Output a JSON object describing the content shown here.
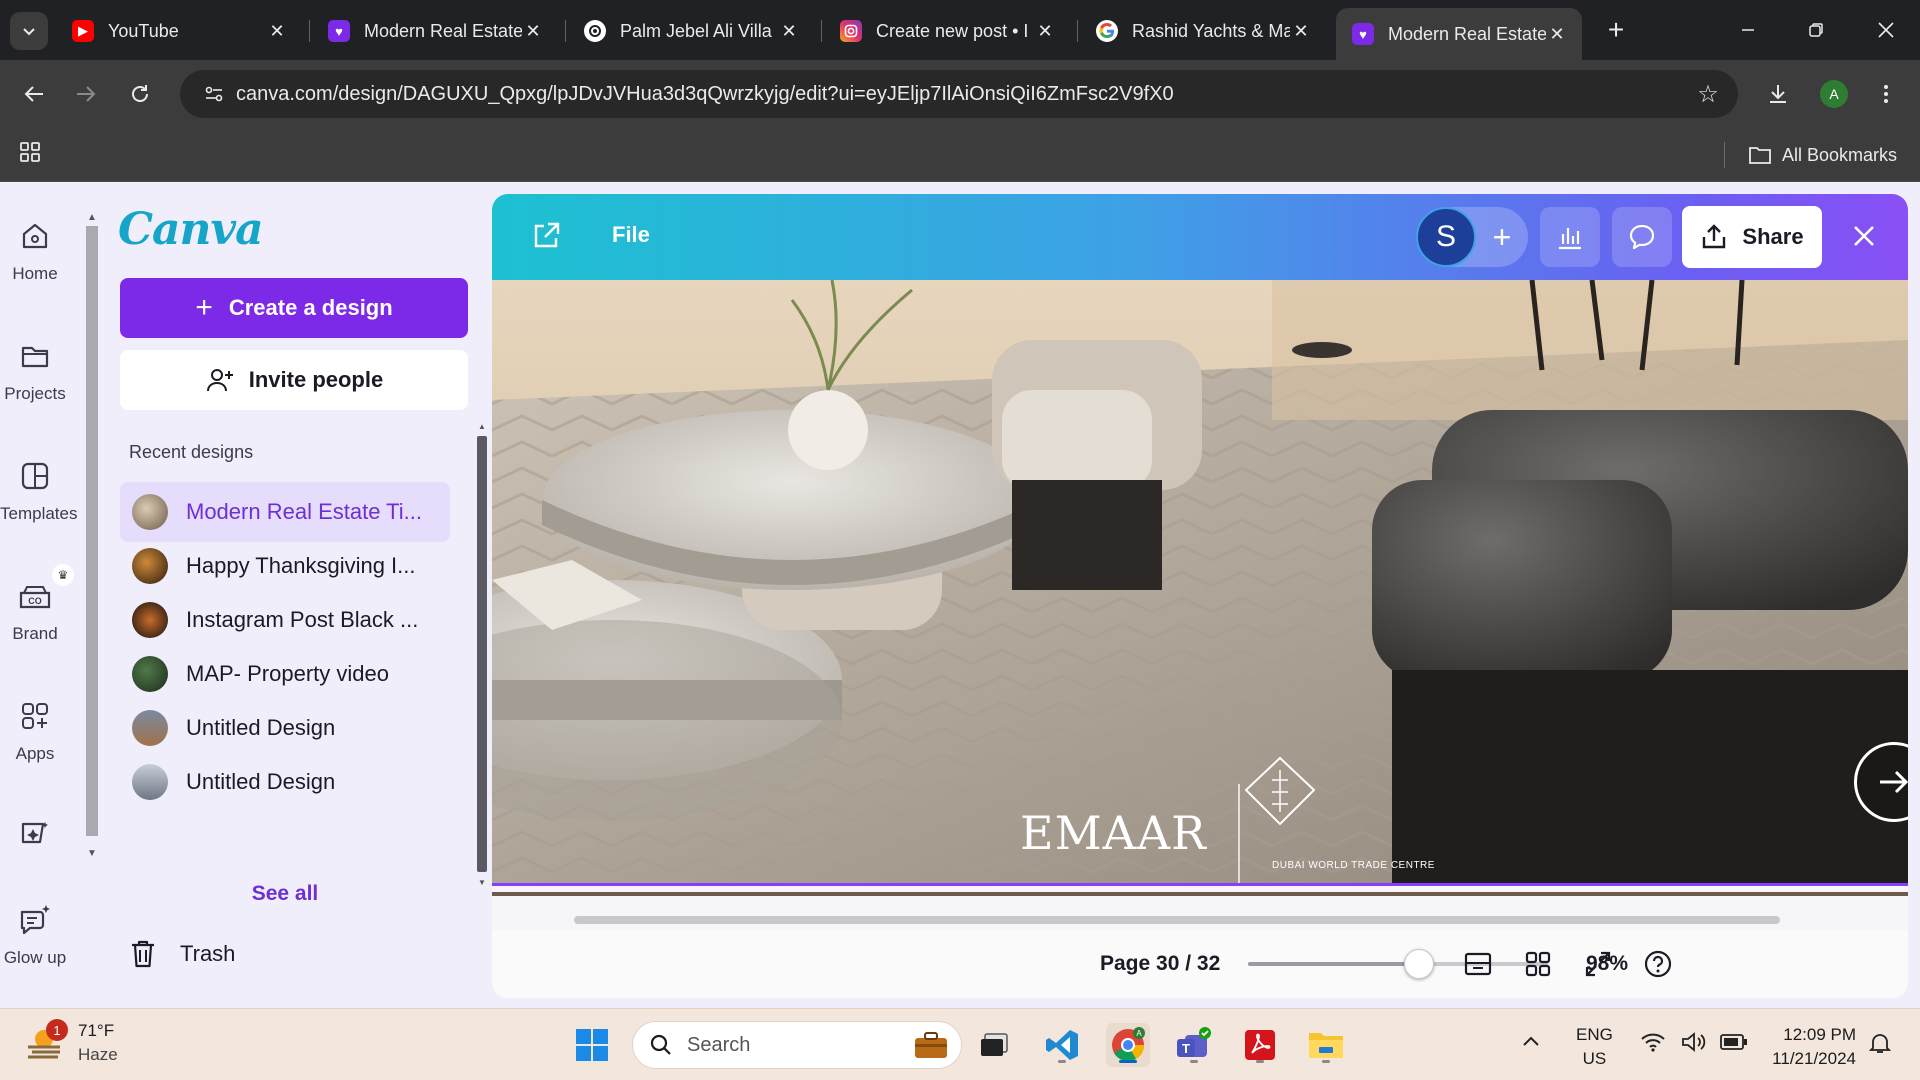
{
  "browser": {
    "tabs": [
      {
        "title": "YouTube",
        "favicon": "youtube-icon",
        "color": "#ff0000"
      },
      {
        "title": "Modern Real Estate",
        "favicon": "canva-heart-icon",
        "color": "#7d2ae8"
      },
      {
        "title": "Palm Jebel Ali Villa",
        "favicon": "chatgpt-icon",
        "color": "#ffffff"
      },
      {
        "title": "Create new post • I",
        "favicon": "instagram-icon",
        "color": "#e1306c"
      },
      {
        "title": "Rashid Yachts & Mar",
        "favicon": "google-icon",
        "color": "#ffffff"
      },
      {
        "title": "Modern Real Estate",
        "favicon": "canva-heart-icon",
        "color": "#7d2ae8",
        "active": true
      }
    ],
    "url": "canva.com/design/DAGUXU_Qpxg/lpJDvJVHua3d3qQwrzkyjg/edit?ui=eyJEljp7IlAiOnsiQiI6ZmFsc2V9fX0",
    "profile_initial": "A",
    "bookmarks_label": "All Bookmarks"
  },
  "canva": {
    "logo": "Canva",
    "rail": [
      {
        "label": "Home",
        "icon": "home-icon"
      },
      {
        "label": "Projects",
        "icon": "folder-icon"
      },
      {
        "label": "Templates",
        "icon": "templates-icon"
      },
      {
        "label": "Brand",
        "icon": "brand-icon"
      },
      {
        "label": "Apps",
        "icon": "apps-icon"
      },
      {
        "label": "",
        "icon": "dream-lab-icon"
      },
      {
        "label": "Glow up",
        "icon": "glow-up-icon"
      }
    ],
    "create_label": "Create a design",
    "invite_label": "Invite people",
    "recent_heading": "Recent designs",
    "recent": [
      {
        "label": "Modern Real Estate Ti...",
        "selected": true
      },
      {
        "label": "Happy Thanksgiving I..."
      },
      {
        "label": "Instagram Post Black ..."
      },
      {
        "label": "MAP- Property video"
      },
      {
        "label": "Untitled Design"
      },
      {
        "label": "Untitled Design"
      }
    ],
    "see_all": "See all",
    "trash": "Trash",
    "viewer": {
      "file_label": "File",
      "collaborator_initial": "S",
      "share_label": "Share",
      "slide_logo_left": "EMAAR",
      "slide_logo_right": "DUBAI WORLD TRADE CENTRE",
      "page_label": "Page 30 / 32",
      "zoom_label": "98%",
      "zoom_level": 0.57
    }
  },
  "taskbar": {
    "weather_temp": "71°F",
    "weather_cond": "Haze",
    "weather_badge": "1",
    "search_placeholder": "Search",
    "lang_1": "ENG",
    "lang_2": "US",
    "time": "12:09 PM",
    "date": "11/21/2024"
  }
}
